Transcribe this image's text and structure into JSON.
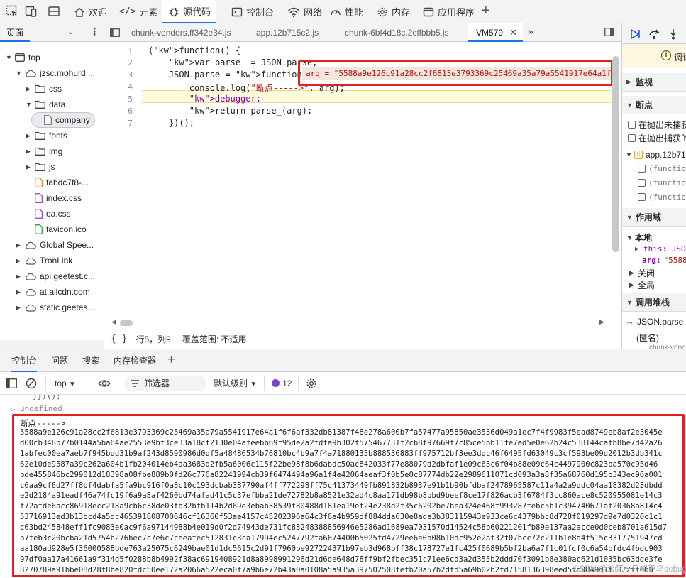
{
  "top_tabs": [
    {
      "label": "欢迎",
      "icon": "home-icon"
    },
    {
      "label": "元素",
      "icon": "code-brackets-icon"
    },
    {
      "label": "源代码",
      "icon": "bug-icon"
    },
    {
      "label": "控制台",
      "icon": "terminal-icon"
    },
    {
      "label": "网络",
      "icon": "wifi-icon"
    },
    {
      "label": "性能",
      "icon": "gauge-icon"
    },
    {
      "label": "内存",
      "icon": "gear-icon"
    },
    {
      "label": "应用程序",
      "icon": "app-window-icon"
    }
  ],
  "nav": {
    "header": "页面",
    "tree": [
      {
        "label": "top",
        "depth": 0,
        "arrow": "▼",
        "icon": "window"
      },
      {
        "label": "jzsc.mohurd....",
        "depth": 1,
        "arrow": "▼",
        "icon": "cloud"
      },
      {
        "label": "css",
        "depth": 2,
        "arrow": "▶",
        "icon": "folder"
      },
      {
        "label": "data",
        "depth": 2,
        "arrow": "▼",
        "icon": "folder"
      },
      {
        "label": "company",
        "depth": 3,
        "arrow": "",
        "icon": "file-gray",
        "selected": true
      },
      {
        "label": "fonts",
        "depth": 2,
        "arrow": "▶",
        "icon": "folder"
      },
      {
        "label": "img",
        "depth": 2,
        "arrow": "▶",
        "icon": "folder"
      },
      {
        "label": "js",
        "depth": 2,
        "arrow": "▶",
        "icon": "folder"
      },
      {
        "label": "fabdc7f8-...",
        "depth": 2,
        "arrow": "",
        "icon": "file-orange"
      },
      {
        "label": "index.css",
        "depth": 2,
        "arrow": "",
        "icon": "file-purple"
      },
      {
        "label": "oa.css",
        "depth": 2,
        "arrow": "",
        "icon": "file-purple"
      },
      {
        "label": "favicon.ico",
        "depth": 2,
        "arrow": "",
        "icon": "file-green"
      },
      {
        "label": "Global Spee...",
        "depth": 1,
        "arrow": "▶",
        "icon": "cloud"
      },
      {
        "label": "TronLink",
        "depth": 1,
        "arrow": "▶",
        "icon": "cloud"
      },
      {
        "label": "api.geetest.c...",
        "depth": 1,
        "arrow": "▶",
        "icon": "cloud"
      },
      {
        "label": "at.alicdn.com",
        "depth": 1,
        "arrow": "▶",
        "icon": "cloud"
      },
      {
        "label": "static.geetes...",
        "depth": 1,
        "arrow": "▶",
        "icon": "cloud"
      }
    ]
  },
  "editor_tabs": [
    "chunk-vendors.ff342e34.js",
    "app.12b715c2.js",
    "chunk-6bf4d18c.2cffbbb5.js",
    "VM579"
  ],
  "code_lines": [
    {
      "n": "1",
      "text": "(function() {"
    },
    {
      "n": "2",
      "text": "    var parse_ = JSON.parse;"
    },
    {
      "n": "3",
      "text": "    JSON.parse = function(arg) {"
    },
    {
      "n": "4",
      "text": "        console.log(\"断点----->\", arg);"
    },
    {
      "n": "5",
      "text": "        debugger;"
    },
    {
      "n": "6",
      "text": "        return parse_(arg);"
    },
    {
      "n": "7",
      "text": "    })();"
    }
  ],
  "inline_hint": "arg = \"5588a9e126c91a28cc2f6813e3793369c25469a35a79a5541917e64a1f",
  "statusbar": {
    "braces": "{ }",
    "position": "行5，列9",
    "coverage": "覆盖范围: 不适用"
  },
  "debugger": {
    "paused_label": "调试",
    "sections": {
      "watch": "监视",
      "breakpoints": "断点",
      "scope": "作用域",
      "callstack": "调用堆栈"
    },
    "bp_options": [
      "在抛出未捕获",
      "在抛出捕获的"
    ],
    "bp_file": "app.12b71",
    "bp_items": [
      "(functio",
      "(functio",
      "(functio"
    ],
    "scope": {
      "local": "本地",
      "this_label": "this: JSON",
      "arg_label": "arg:",
      "arg_val": "\"5588",
      "closure": "关闭",
      "global": "全局"
    },
    "stack": [
      {
        "name": "JSON.parse"
      },
      {
        "name": "(匿名)"
      },
      {
        "name": "chunk-vend"
      }
    ]
  },
  "drawer_tabs": [
    "控制台",
    "问题",
    "搜索",
    "内存检查器"
  ],
  "console_toolbar": {
    "context": "top",
    "filter_placeholder": "筛选器",
    "level": "默认级别",
    "issue_count": "12"
  },
  "console": {
    "prev_tail": "}})();",
    "undefined": "undefined",
    "log_label": "断点----->",
    "hex_lines": [
      "5588a9e126c91a28cc2f6813e3793369c25469a35a79a5541917e64a1f6f6af332db81387f48e278a600b7fa57477a95850ae3536d049a1ec7f4f9983f5ead8749eb8af2e3045e",
      "d00cb348b77b0144a5ba64ae2553e9bf3ce33a18cf2130e04afeebb69f95de2a2fdfa9b302f575467731f2cb8f97669f7c85ce5bb11fe7ed5e0e62b24c538144cafb8be7d42a26",
      "1abfec00ea7aeb7f945bdd31b9af243d8590986d0df5a48486534b76810bc4b9a7f4a71880135b888536883ff975712bf3ee3ddc46f6495fd63049c3cf593be09d2012b3db341c",
      "62e10de9587a39c262a604b1fb204014eb4aa3683d2fb5a6006c115f22be98f8b6dabdc50ac842033f77e88079d2dbfaf1e09c63c6f04b88e09c64c4497900c823ba570c95d46",
      "bde455846bc299012d18398a08fbe889b0fd26c776a82241994cb39f6474494a96a1f4e42064aeaf3f0b5e0c87774db22e2989611071cd093a3a8f35a68760d195b343ec96a001",
      "c6aa9cf6d27ff8bf4dabfa5fa9bc916f0a8c10c193dcbab387790af4ff772298ff75c41373449fb891832b8937e91b1b90bfdbaf2478965587c11a4a2a9ddc04aa18382d23dbdd",
      "e2d2184a91eadf46a74fc19f6a9a8af4260bd74afad41c5c37efbba21de72782b8a8521e32ad4c8aa171db98b8bbd9beef8ce17f826acb3f6784f3cc860ace8c520955081e14c3",
      "f72afde6acc86918ecc218a9cb6c38de03fb32bfb114b2d69e3ebab38539f80488d181ea19ef24e238d2f35c6202be7bea324e468f993287febc5b1c394740671af20368a814c4",
      "53716913ed3b13bcd4a5dc465391808700646cf16360f53ae4157c45202396a64c3f6a4b959df884dda630e8ada3b383115943e933ce6c4379bbc8d728f019297d9e7d0320c1c1",
      "c63bd245848eff1fc9083e0ac9f6a97144988b4e019d0f2d74943de731fc88248388856946e5286ad1689ea7031570d14524c58b60221201fb89e137aa2acce0d0ceb8701a615d7",
      "b7feb3c20bcba21d5754b276bec7c7e6c7ceeafec512831c3ca17994ec5247792fa6674400b5025fd4729ee6e0b08b10dc952e2af32f07bcc72c211b1e8a4f515c3317751947cd",
      "aa180ad928e5f36000588bde763a25075c6249bae01d1dc5615c2d91f7960be927224371b97eb3d968bff38c178727e1fc425f0689b5bf2ba6a7f1c01fcf0c6a54bfdc4fbdc903",
      "97df0aa17a41661a9f314d5f0288b8b4992f38ac6919408921d8a8998991296d21d6de648d78ff9bf2fbec351c71ee6cd3a2d355b2ddd70f3091b8e380ac621d1035bc63dde3fe",
      "8270789a91bbe08d28f8be820fdc50ee172a2066a522eca0f7a9b6e72b43a0a0108a5a935a397502508fefb20a57b2dfd5a69b02b2fd7158136398eed5fd9849d1f3372ff0b0"
    ],
    "watermark": "CSDN @杀死一只知更鸟debug"
  }
}
